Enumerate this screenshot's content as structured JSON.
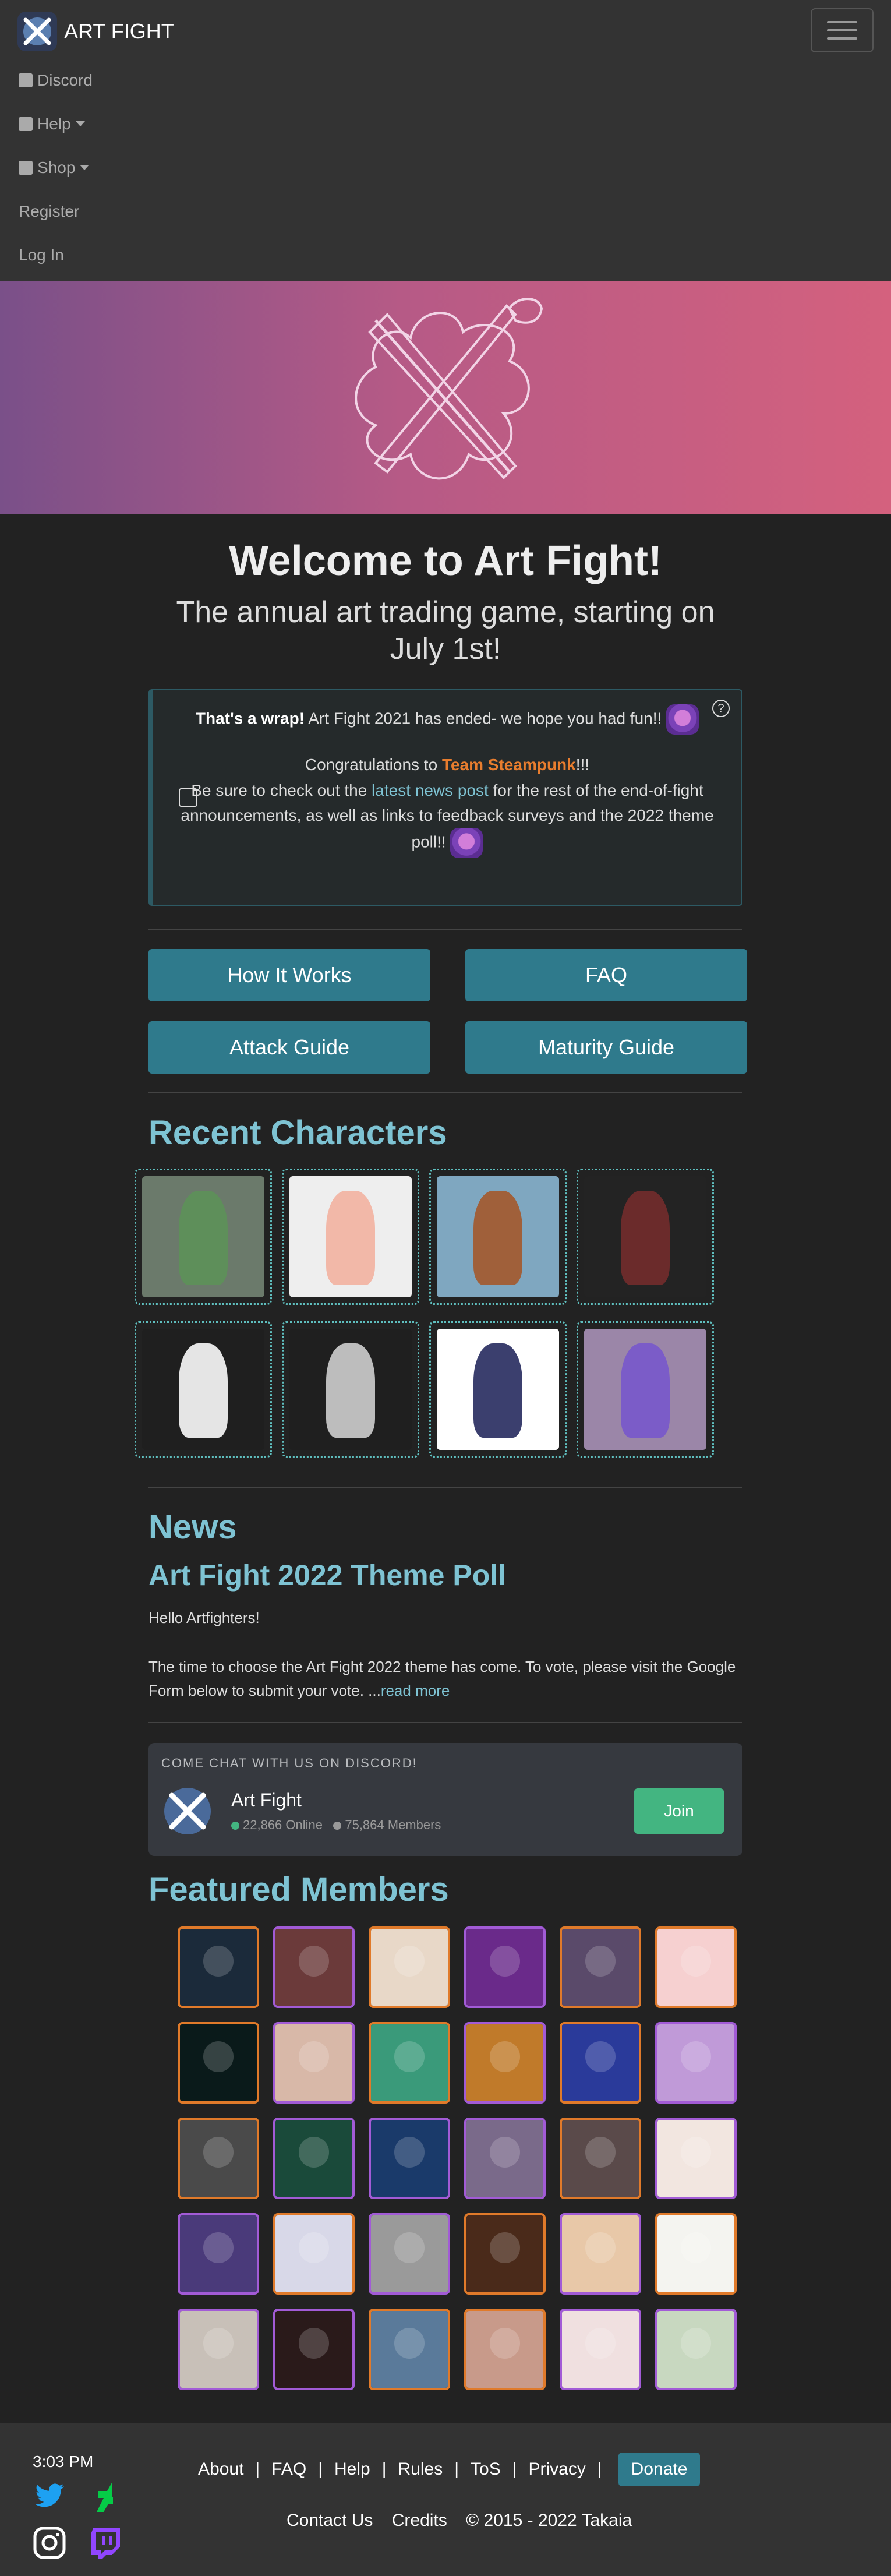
{
  "nav": {
    "brand": "ART FIGHT",
    "items": [
      {
        "label": "Discord",
        "icon": "discord-icon",
        "caret": false
      },
      {
        "label": "Help",
        "icon": "question-icon",
        "caret": true
      },
      {
        "label": "Shop",
        "icon": "cart-icon",
        "caret": true
      },
      {
        "label": "Register",
        "icon": "",
        "caret": false
      },
      {
        "label": "Log In",
        "icon": "",
        "caret": false
      }
    ]
  },
  "colors": {
    "accent": "#7ec3d3",
    "button": "#2f7a8c",
    "team": "#e87d2e",
    "join": "#43b581"
  },
  "main": {
    "welcome": "Welcome to Art Fight!",
    "subtitle": "The annual art trading game, starting on July 1st!"
  },
  "alert": {
    "wrap_bold": "That's a wrap!",
    "wrap_text": " Art Fight 2021 has ended- we hope you had fun!!",
    "congrats_pre": "Congratulations to ",
    "team": "Team Steampunk",
    "congrats_post": "!!!",
    "check_pre": "Be sure to check out the ",
    "check_link": "latest news post",
    "check_post": " for the rest of the end-of-fight announcements, as well as links to feedback surveys and the 2022 theme poll!!"
  },
  "buttons": {
    "how_it_works": "How It Works",
    "faq": "FAQ",
    "attack_guide": "Attack Guide",
    "maturity_guide": "Maturity Guide"
  },
  "recent": {
    "title": "Recent Characters",
    "thumbs": [
      {
        "bg": "#6b7a6b",
        "fg": "#5e8f5a"
      },
      {
        "bg": "#eeeeee",
        "fg": "#f2b8a8"
      },
      {
        "bg": "#7fa7c0",
        "fg": "#a0603a"
      },
      {
        "bg": "#232323",
        "fg": "#6b2b2b"
      },
      {
        "bg": "#1f1f1f",
        "fg": "#e5e5e5"
      },
      {
        "bg": "#1f1f1f",
        "fg": "#bdbdbd"
      },
      {
        "bg": "#ffffff",
        "fg": "#3b3f6e"
      },
      {
        "bg": "#9b86a8",
        "fg": "#7b5cc8"
      }
    ]
  },
  "news": {
    "title": "News",
    "post_title": "Art Fight 2022 Theme Poll",
    "p1": "Hello Artfighters!",
    "p2": "The time to choose the Art Fight 2022 theme has come. To vote, please visit the Google Form below to submit your vote. ...",
    "read_more": "read more"
  },
  "discord": {
    "title": "COME CHAT WITH US ON DISCORD!",
    "server": "Art Fight",
    "online": "22,866 Online",
    "members": "75,864 Members",
    "join": "Join"
  },
  "featured": {
    "title": "Featured Members",
    "members": [
      {
        "border": "orange",
        "bg": "#1b2a3a"
      },
      {
        "border": "purple",
        "bg": "#6b3a3a"
      },
      {
        "border": "orange",
        "bg": "#e8d8c8"
      },
      {
        "border": "purple",
        "bg": "#6a2a8a"
      },
      {
        "border": "orange",
        "bg": "#5a4a6a"
      },
      {
        "border": "orange",
        "bg": "#f6d0d0"
      },
      {
        "border": "orange",
        "bg": "#0a1a1a"
      },
      {
        "border": "purple",
        "bg": "#d8b8a8"
      },
      {
        "border": "orange",
        "bg": "#3a9a7a"
      },
      {
        "border": "purple",
        "bg": "#c07a2a"
      },
      {
        "border": "orange",
        "bg": "#2a3a9a"
      },
      {
        "border": "purple",
        "bg": "#c09ad8"
      },
      {
        "border": "orange",
        "bg": "#4a4a4a"
      },
      {
        "border": "purple",
        "bg": "#1a4a3a"
      },
      {
        "border": "purple",
        "bg": "#1a3a6a"
      },
      {
        "border": "purple",
        "bg": "#7a6a8a"
      },
      {
        "border": "orange",
        "bg": "#5a4a4a"
      },
      {
        "border": "purple",
        "bg": "#f2e6e0"
      },
      {
        "border": "purple",
        "bg": "#4a3a7a"
      },
      {
        "border": "orange",
        "bg": "#d8d8e8"
      },
      {
        "border": "purple",
        "bg": "#9a9a9a"
      },
      {
        "border": "orange",
        "bg": "#4a2a1a"
      },
      {
        "border": "purple",
        "bg": "#e8c8a8"
      },
      {
        "border": "orange",
        "bg": "#f4f4f0"
      },
      {
        "border": "purple",
        "bg": "#c8c0b8"
      },
      {
        "border": "purple",
        "bg": "#2a1a1a"
      },
      {
        "border": "orange",
        "bg": "#5a7a9a"
      },
      {
        "border": "orange",
        "bg": "#c89a8a"
      },
      {
        "border": "purple",
        "bg": "#f0e0e0"
      },
      {
        "border": "purple",
        "bg": "#c8d8c0"
      }
    ]
  },
  "footer": {
    "time": "3:03 PM",
    "links": [
      "About",
      "FAQ",
      "Help",
      "Rules",
      "ToS",
      "Privacy"
    ],
    "donate": "Donate",
    "contact": "Contact Us",
    "credits": "Credits",
    "copyright": "© 2015 - 2022 Takaia",
    "icons": [
      "twitter-icon",
      "deviantart-icon",
      "instagram-icon",
      "twitch-icon"
    ]
  }
}
